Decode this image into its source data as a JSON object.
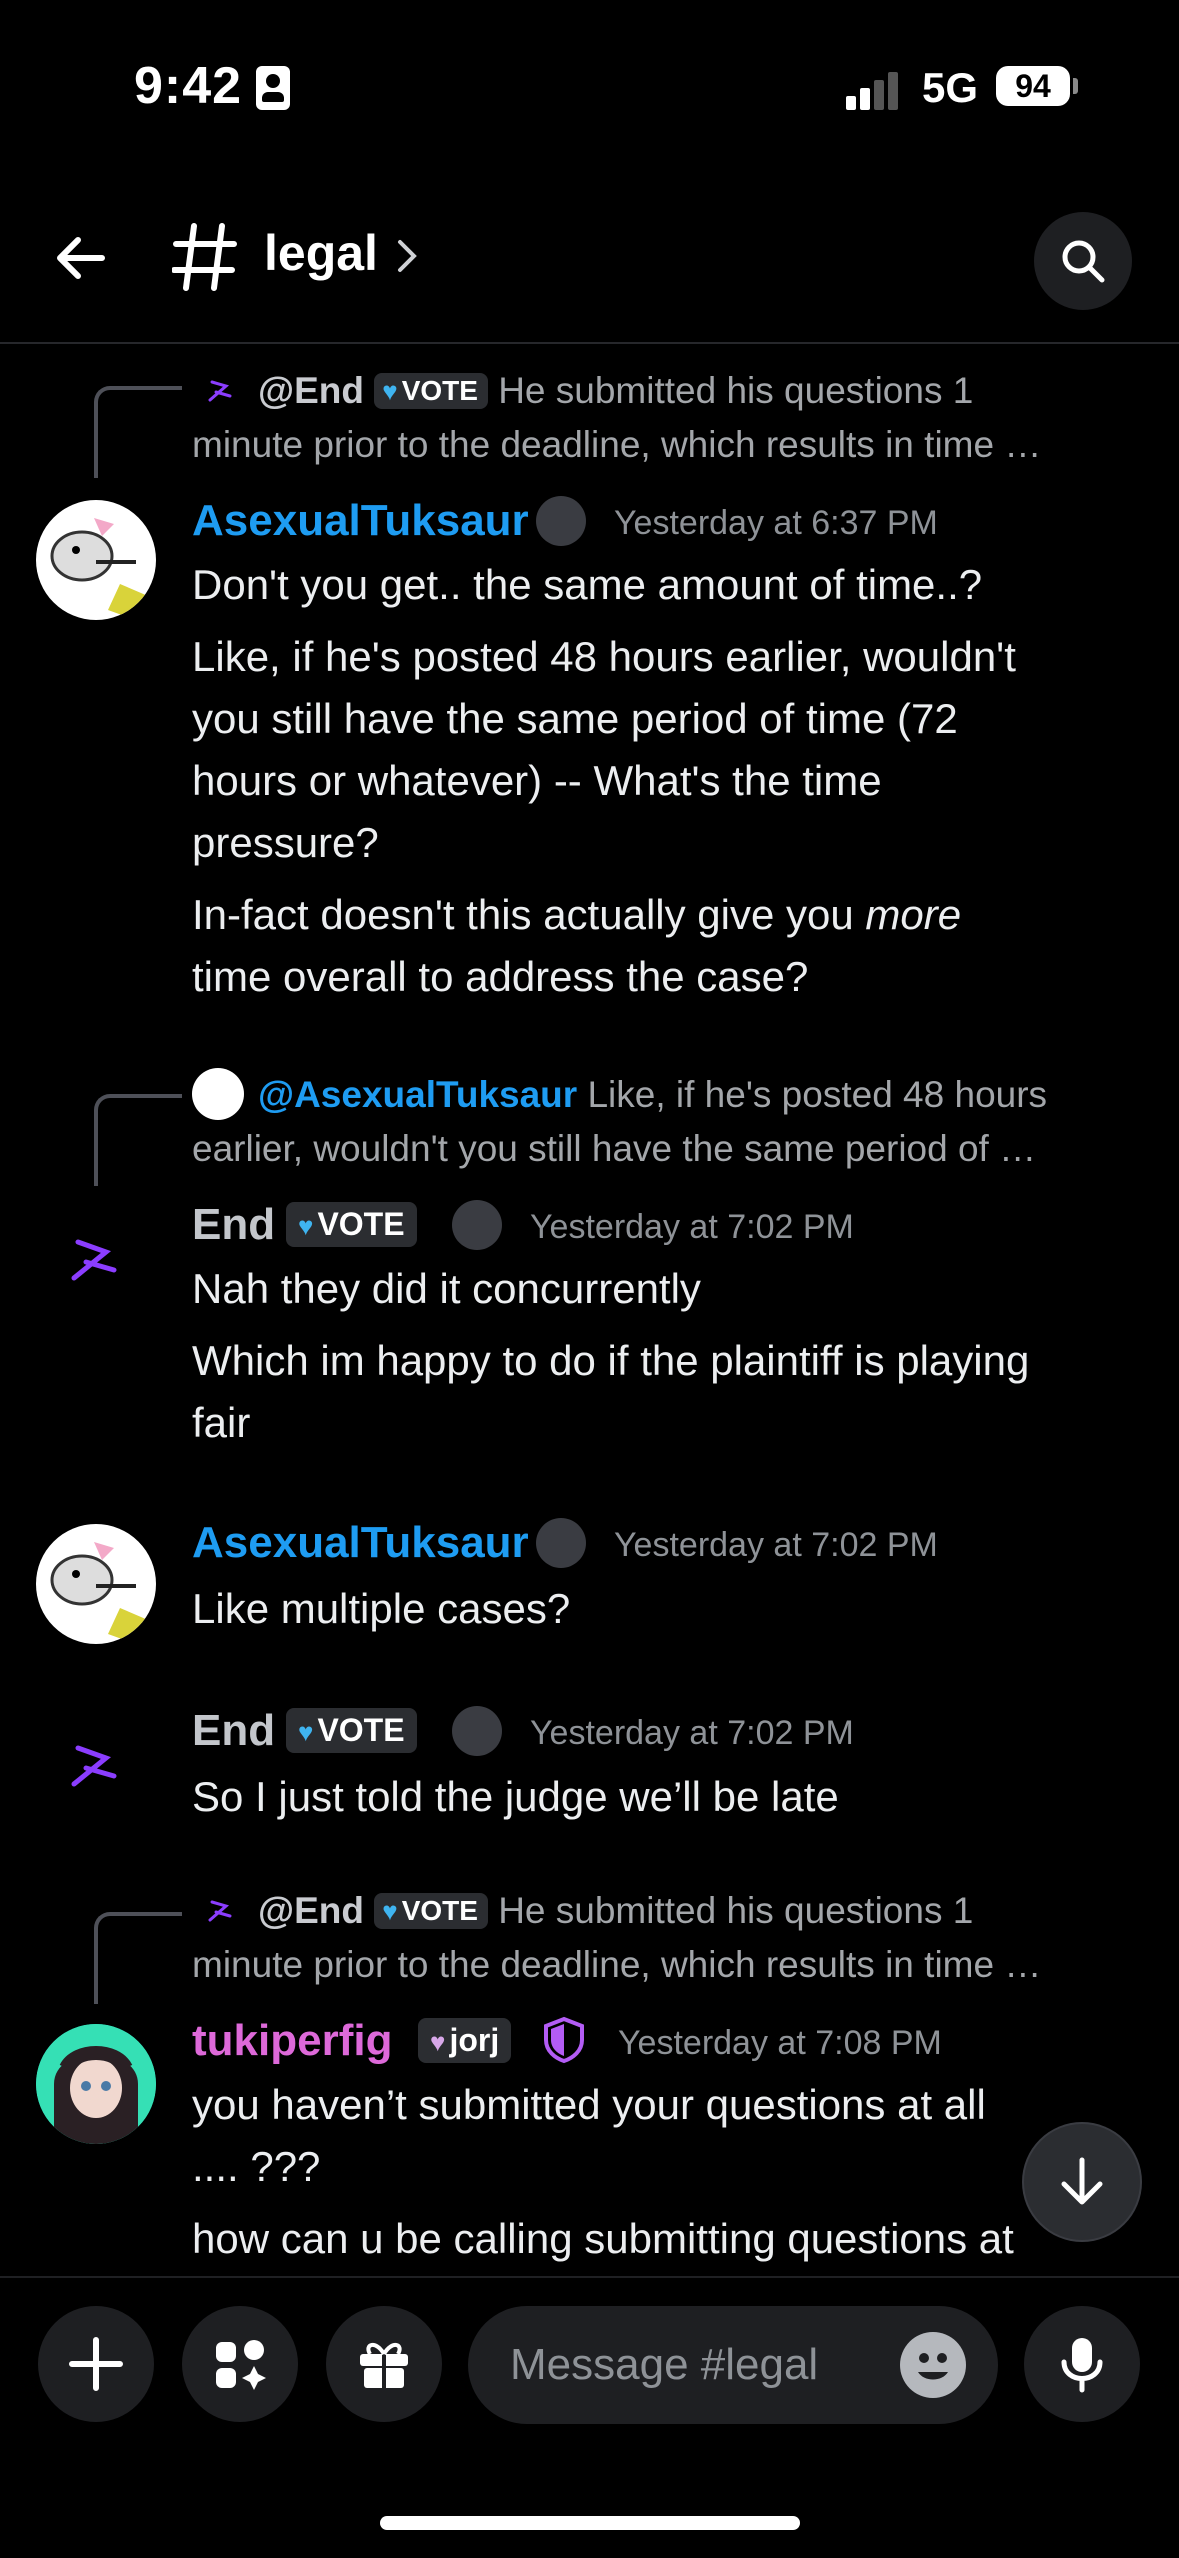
{
  "status": {
    "time": "9:42",
    "network": "5G",
    "battery": "94"
  },
  "header": {
    "channel": "legal"
  },
  "messages": [
    {
      "reply": {
        "mention": "@End",
        "tag": "VOTE",
        "text": "He submitted his questions 1",
        "text2": "minute prior to the deadline, which results in time …"
      },
      "author": "AsexualTuksaur",
      "time": "Yesterday at 6:37 PM",
      "lines": [
        "Don't you get.. the same amount of time..?",
        "Like, if he's posted 48 hours earlier, wouldn't",
        "you still have the same period of time (72",
        "hours or whatever) -- What's the time",
        "pressure?",
        "In-fact doesn't this actually give you ",
        "more",
        "time overall to address the case?"
      ]
    },
    {
      "reply": {
        "mention": "@AsexualTuksaur",
        "text": "Like, if he's posted 48 hours",
        "text2": "earlier, wouldn't you still have the same period of …"
      },
      "author": "End",
      "tag": "VOTE",
      "time": "Yesterday at 7:02 PM",
      "lines": [
        "Nah they did it concurrently",
        "Which im happy to do if the plaintiff is playing",
        "fair"
      ]
    },
    {
      "author": "AsexualTuksaur",
      "time": "Yesterday at 7:02 PM",
      "lines": [
        "Like multiple cases?"
      ]
    },
    {
      "author": "End",
      "tag": "VOTE",
      "time": "Yesterday at 7:02 PM",
      "lines": [
        "So I just told the judge we’ll be late"
      ]
    },
    {
      "reply": {
        "mention": "@End",
        "tag": "VOTE",
        "text": "He submitted his questions 1",
        "text2": "minute prior to the deadline, which results in time …"
      },
      "author": "tukiperfig",
      "tag": "jorj",
      "time": "Yesterday at 7:08 PM",
      "lines": [
        "you haven’t submitted your questions at all",
        ".... ???",
        "how can u be calling submitting questions at"
      ]
    }
  ],
  "composer": {
    "placeholder": "Message #legal"
  },
  "colors": {
    "link_blue": "#1e9cf2",
    "pink_name": "#dd69d9",
    "purple_icon": "#8b3dff",
    "background": "#000000"
  }
}
